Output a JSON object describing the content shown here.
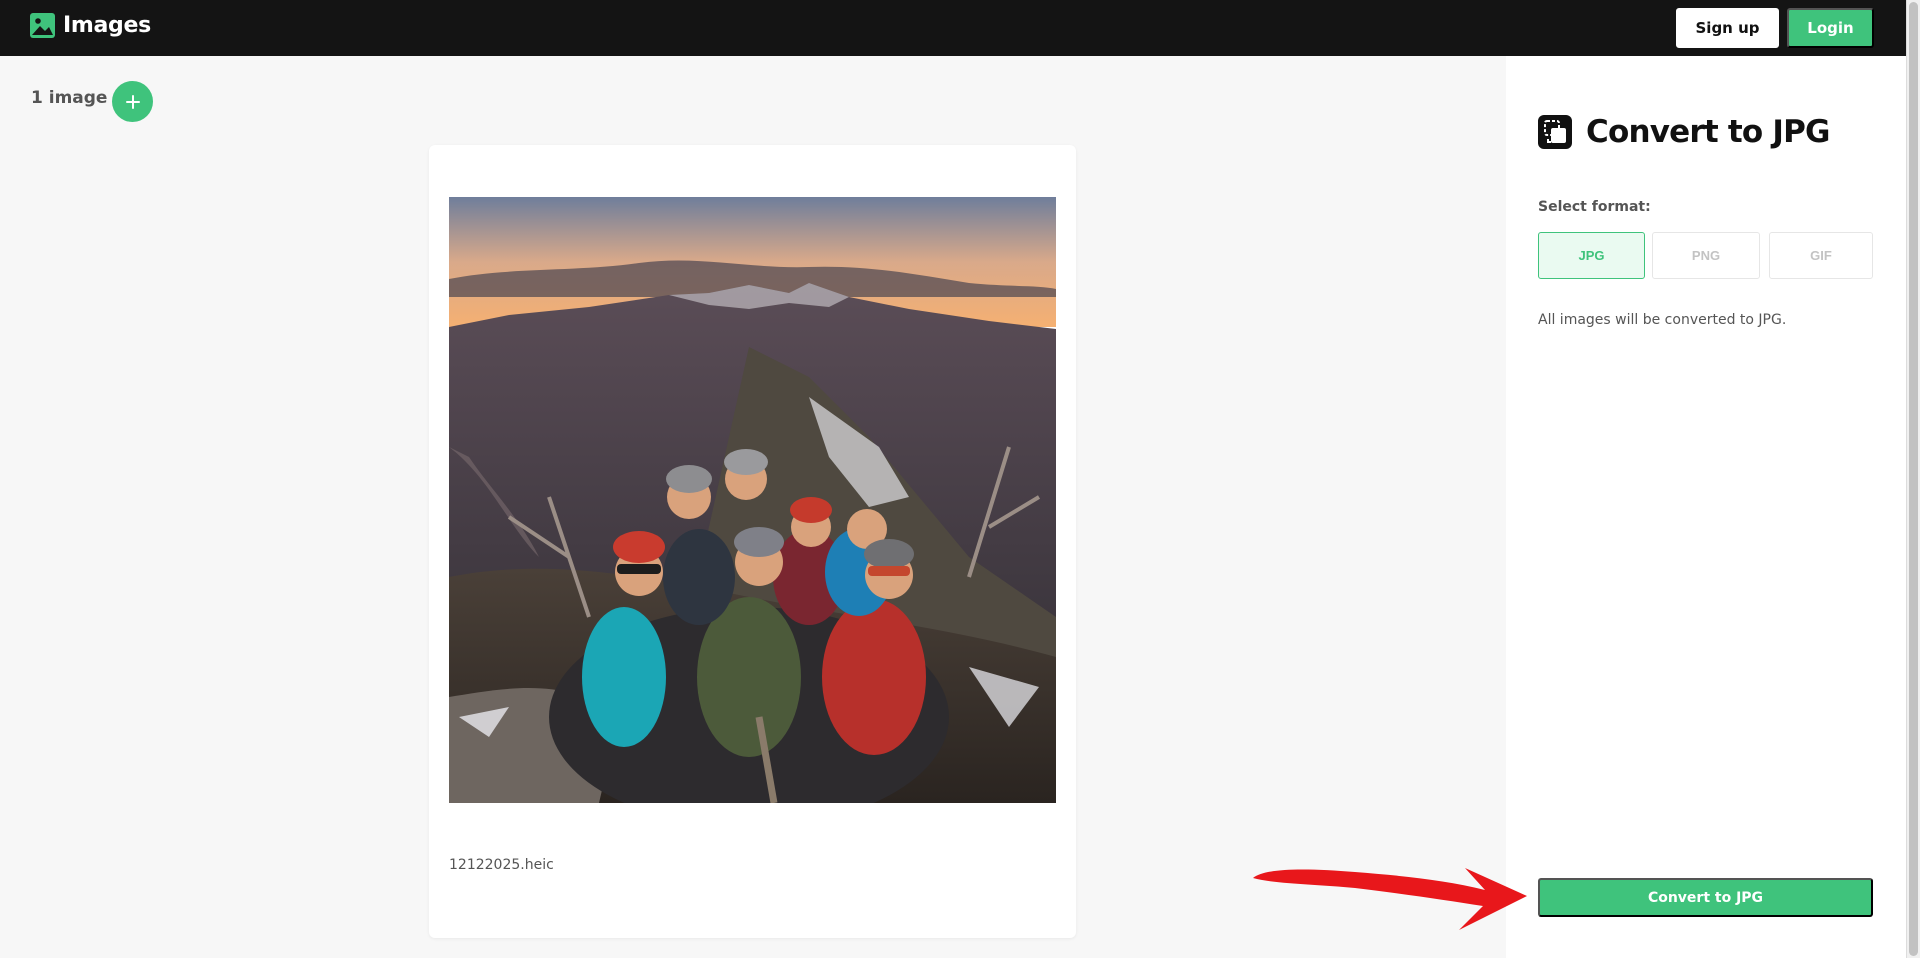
{
  "header": {
    "brand": "Images",
    "signup_label": "Sign up",
    "login_label": "Login"
  },
  "workspace": {
    "count_label": "1 image",
    "add_icon": "plus-icon",
    "file": {
      "name": "12122025.heic"
    }
  },
  "panel": {
    "title": "Convert to JPG",
    "icon": "convert-image-icon",
    "format_label": "Select format:",
    "formats": [
      {
        "label": "JPG",
        "selected": true
      },
      {
        "label": "PNG",
        "selected": false
      },
      {
        "label": "GIF",
        "selected": false
      }
    ],
    "note": "All images will be converted to JPG.",
    "convert_label": "Convert to JPG"
  },
  "colors": {
    "accent": "#3fc37c",
    "header_bg": "#141414",
    "annotation": "#e8171b"
  }
}
